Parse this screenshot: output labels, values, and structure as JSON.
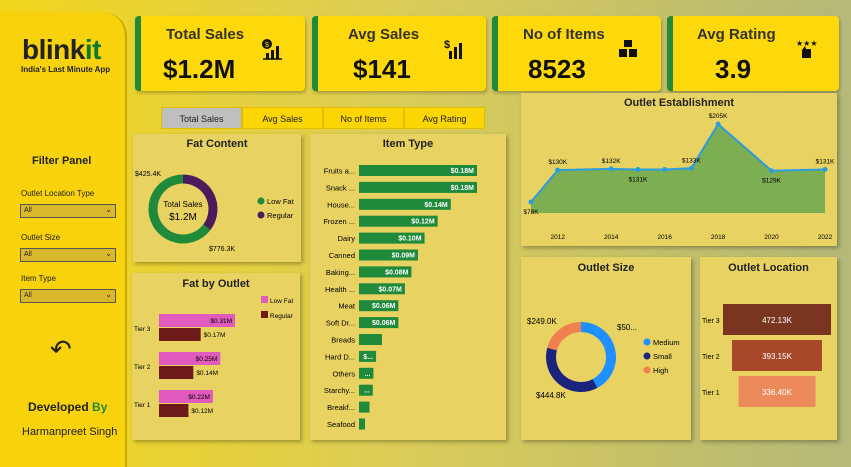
{
  "brand": {
    "name_a": "blink",
    "name_b": "it",
    "tagline": "India's Last Minute App"
  },
  "filter": {
    "title": "Filter Panel",
    "fields": [
      {
        "label": "Outlet Location Type",
        "value": "All"
      },
      {
        "label": "Outlet Size",
        "value": "All"
      },
      {
        "label": "Item Type",
        "value": "All"
      }
    ]
  },
  "dev": {
    "a": "Developed ",
    "b": "By",
    "name": "Harmanpreet Singh"
  },
  "kpis": [
    {
      "title": "Total Sales",
      "value": "$1.2M",
      "icon": "money-chart-icon"
    },
    {
      "title": "Avg Sales",
      "value": "$141",
      "icon": "dollar-bars-icon"
    },
    {
      "title": "No of Items",
      "value": "8523",
      "icon": "boxes-icon"
    },
    {
      "title": "Avg Rating",
      "value": "3.9",
      "icon": "star-rating-icon"
    }
  ],
  "tabs": [
    "Total Sales",
    "Avg Sales",
    "No of Items",
    "Avg Rating"
  ],
  "colors": {
    "green": "#1e8a3a",
    "purple": "#4b1b5c",
    "pink": "#e05bbd",
    "maroon": "#6e1a1a",
    "blue": "#1e90ff",
    "navy": "#1a237e",
    "orange": "#f08050"
  },
  "chart_data": [
    {
      "id": "fat",
      "type": "pie",
      "title": "Fat Content",
      "center_title": "Total Sales",
      "center_value": "$1.2M",
      "categories": [
        "Low Fat",
        "Regular"
      ],
      "values": [
        776.3,
        425.4
      ],
      "labels": [
        "$776.3K",
        "$425.4K"
      ]
    },
    {
      "id": "item",
      "type": "bar",
      "title": "Item Type",
      "categories": [
        "Fruits a...",
        "Snack ...",
        "House...",
        "Frozen ...",
        "Dairy",
        "Canned",
        "Baking...",
        "Health ...",
        "Meat",
        "Soft Dr...",
        "Breads",
        "Hard D...",
        "Others",
        "Starchy...",
        "Breakf...",
        "Seafood"
      ],
      "values": [
        0.18,
        0.18,
        0.14,
        0.12,
        0.1,
        0.09,
        0.08,
        0.07,
        0.06,
        0.06,
        0.035,
        0.026,
        0.022,
        0.021,
        0.016,
        0.009
      ],
      "labels": [
        "$0.18M",
        "$0.18M",
        "$0.14M",
        "$0.12M",
        "$0.10M",
        "$0.09M",
        "$0.08M",
        "$0.07M",
        "$0.06M",
        "$0.06M",
        "",
        "$...",
        "...",
        "...",
        "",
        ""
      ]
    },
    {
      "id": "est",
      "type": "area",
      "title": "Outlet Establishment",
      "x": [
        2011,
        2012,
        2014,
        2015,
        2016,
        2017,
        2018,
        2020,
        2022
      ],
      "values": [
        78,
        130,
        132,
        131,
        131,
        133,
        205,
        129,
        131
      ],
      "labels": [
        "$78K",
        "$130K",
        "$132K",
        "$131K",
        "",
        "$133K",
        "$205K",
        "$129K",
        "$131K"
      ],
      "xticks": [
        "2012",
        "2014",
        "2016",
        "2018",
        "2020",
        "2022"
      ]
    },
    {
      "id": "fbo",
      "type": "bar",
      "title": "Fat by Outlet",
      "categories": [
        "Tier 3",
        "Tier 2",
        "Tier 1"
      ],
      "series": [
        {
          "name": "Low Fat",
          "values": [
            0.31,
            0.25,
            0.22
          ],
          "labels": [
            "$0.31M",
            "$0.25M",
            "$0.22M"
          ]
        },
        {
          "name": "Regular",
          "values": [
            0.17,
            0.14,
            0.12
          ],
          "labels": [
            "$0.17M",
            "$0.14M",
            "$0.12M"
          ]
        }
      ]
    },
    {
      "id": "size",
      "type": "pie",
      "title": "Outlet Size",
      "categories": [
        "Medium",
        "Small",
        "High"
      ],
      "values": [
        507,
        444.8,
        249
      ],
      "labels": [
        "$50...",
        "$444.8K",
        "$249.0K"
      ]
    },
    {
      "id": "loc",
      "type": "bar",
      "title": "Outlet Location",
      "categories": [
        "Tier 3",
        "Tier 2",
        "Tier 1"
      ],
      "values": [
        472.13,
        393.15,
        336.4
      ],
      "labels": [
        "472.13K",
        "393.15K",
        "336.40K"
      ],
      "colors": [
        "#7a3520",
        "#a8482a",
        "#ec8a5c"
      ]
    }
  ]
}
